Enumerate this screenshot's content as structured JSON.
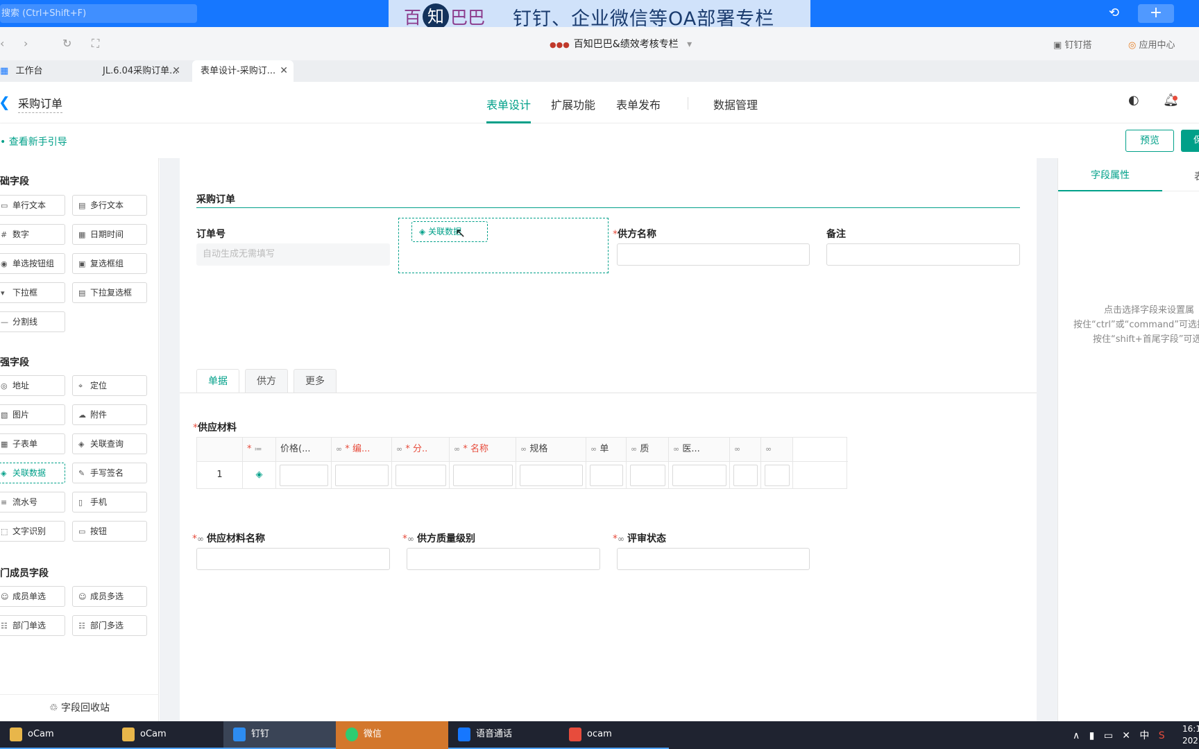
{
  "topbar": {
    "search_placeholder": "搜索 (Ctrl+Shift+F)",
    "banner_logo_1": "百",
    "banner_logo_2": "知",
    "banner_logo_3": "巴巴",
    "banner_title": "钉钉、企业微信等OA部署专栏"
  },
  "browser": {
    "site_title": "百知巴巴&绩效考核专栏",
    "dingda": "钉钉搭",
    "app_center": "应用中心"
  },
  "tabs": [
    {
      "label": "工作台"
    },
    {
      "label": "JL.6.04采购订单..."
    },
    {
      "label": "表单设计-采购订..."
    }
  ],
  "app": {
    "form_name": "采购订单",
    "nav": [
      "表单设计",
      "扩展功能",
      "表单发布",
      "数据管理"
    ],
    "guide": "查看新手引导",
    "preview": "预览",
    "save": "保"
  },
  "left": {
    "groups": [
      "础字段",
      "强字段",
      "门成员字段"
    ],
    "basic": [
      [
        "单行文本",
        "多行文本"
      ],
      [
        "数字",
        "日期时间"
      ],
      [
        "单选按钮组",
        "复选框组"
      ],
      [
        "下拉框",
        "下拉复选框"
      ],
      [
        "分割线",
        ""
      ]
    ],
    "enhanced": [
      [
        "地址",
        "定位"
      ],
      [
        "图片",
        "附件"
      ],
      [
        "子表单",
        "关联查询"
      ],
      [
        "关联数据",
        "手写签名"
      ],
      [
        "流水号",
        "手机"
      ],
      [
        "文字识别",
        "按钮"
      ]
    ],
    "members": [
      [
        "成员单选",
        "成员多选"
      ],
      [
        "部门单选",
        "部门多选"
      ]
    ],
    "recycle": "字段回收站"
  },
  "canvas": {
    "section_title": "采购订单",
    "order_no_label": "订单号",
    "order_no_placeholder": "自动生成无需填写",
    "drag_chip": "关联数据",
    "supplier_label": "供方名称",
    "remark_label": "备注",
    "form_tabs": [
      "单据",
      "供方",
      "更多"
    ],
    "material_label": "供应材料",
    "table_headers": [
      "*",
      "价格(...",
      "* 编...",
      "* 分..",
      "* 名称",
      "规格",
      "单",
      "质",
      "医...",
      "",
      ""
    ],
    "row_no": "1",
    "material_name_label": "供应材料名称",
    "quality_level_label": "供方质量级别",
    "review_status_label": "评审状态"
  },
  "right": {
    "tab_field_props": "字段属性",
    "tab_form_props": "表",
    "hint1": "点击选择字段来设置属",
    "hint2": "按住“ctrl”或“command”可选择",
    "hint3": "按住“shift+首尾字段”可选"
  },
  "taskbar": {
    "items": [
      "oCam",
      "oCam",
      "钉钉",
      "微信",
      "语音通话",
      "ocam"
    ],
    "ime": "中",
    "time": "16:1",
    "date": "202"
  }
}
